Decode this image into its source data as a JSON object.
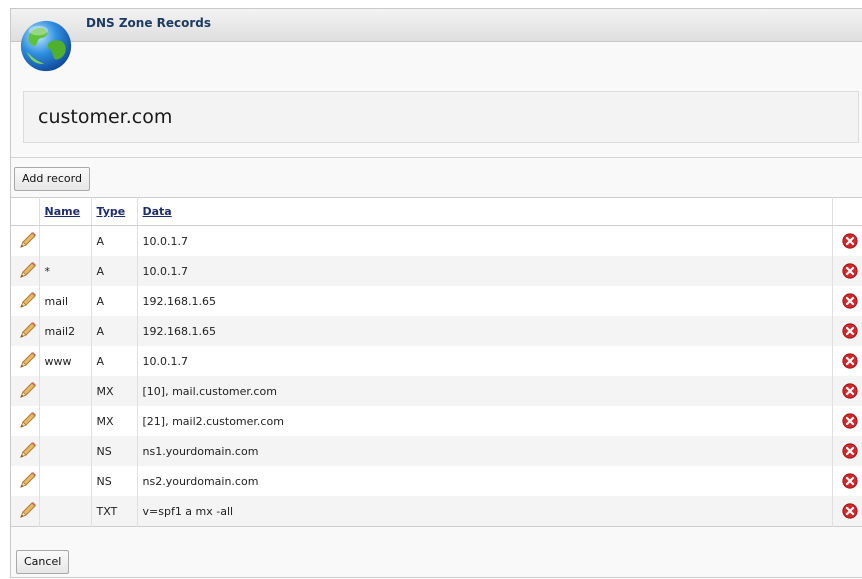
{
  "window": {
    "title": "DNS Zone Records"
  },
  "zone": {
    "name": "customer.com"
  },
  "toolbar": {
    "add_label": "Add record"
  },
  "table": {
    "headers": {
      "name": "Name",
      "type": "Type",
      "data": "Data"
    },
    "rows": [
      {
        "name": "",
        "type": "A",
        "data": "10.0.1.7"
      },
      {
        "name": "*",
        "type": "A",
        "data": "10.0.1.7"
      },
      {
        "name": "mail",
        "type": "A",
        "data": "192.168.1.65"
      },
      {
        "name": "mail2",
        "type": "A",
        "data": "192.168.1.65"
      },
      {
        "name": "www",
        "type": "A",
        "data": "10.0.1.7"
      },
      {
        "name": "",
        "type": "MX",
        "data": "[10], mail.customer.com"
      },
      {
        "name": "",
        "type": "MX",
        "data": "[21], mail2.customer.com"
      },
      {
        "name": "",
        "type": "NS",
        "data": "ns1.yourdomain.com"
      },
      {
        "name": "",
        "type": "NS",
        "data": "ns2.yourdomain.com"
      },
      {
        "name": "",
        "type": "TXT",
        "data": "v=spf1 a mx -all"
      }
    ]
  },
  "footer": {
    "cancel_label": "Cancel"
  },
  "icons": {
    "app": "globe-icon",
    "edit": "pencil-icon",
    "delete": "delete-icon"
  },
  "colors": {
    "title": "#1d3b63",
    "header_link": "#1e2e6b",
    "delete": "#d4262a"
  }
}
